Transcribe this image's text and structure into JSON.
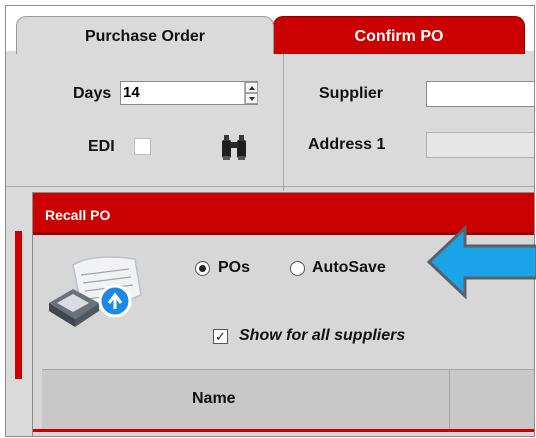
{
  "tabs": [
    {
      "label": "Purchase Order",
      "active": true
    },
    {
      "label": "Confirm PO",
      "active": false
    }
  ],
  "form": {
    "days_label": "Days",
    "days_value": "14",
    "edi_label": "EDI",
    "edi_checked": false,
    "supplier_label": "Supplier",
    "supplier_value": "",
    "address1_label": "Address 1",
    "address1_value": ""
  },
  "dialog": {
    "title": "Recall PO",
    "radio_pos_label": "POs",
    "radio_pos_selected": true,
    "radio_autosave_label": "AutoSave",
    "radio_autosave_selected": false,
    "show_all_label": "Show for all suppliers",
    "show_all_checked": true,
    "table_columns": [
      "Name"
    ]
  },
  "colors": {
    "accent_red": "#cc0000",
    "panel_gray": "#dadada",
    "arrow_blue": "#1aa3e8"
  },
  "icons": [
    "spinner-icon",
    "binoculars-icon",
    "recall-document-icon",
    "arrow-annotation-icon"
  ]
}
